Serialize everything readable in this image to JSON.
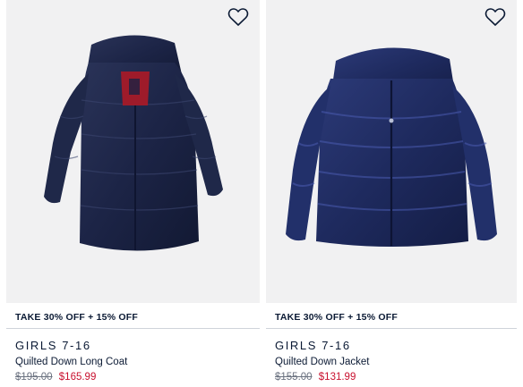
{
  "colors": {
    "text": "#0b1a34",
    "sale_price": "#c8102e",
    "original_price": "#6b7280",
    "image_background": "#f1f1f2",
    "jacket_navy": "#1d2547"
  },
  "products": [
    {
      "promo": "TAKE 30% OFF + 15% OFF",
      "category": "GIRLS 7-16",
      "name": "Quilted Down Long Coat",
      "original_price": "$195.00",
      "sale_price": "$165.99",
      "wishlist_icon": "heart-outline-icon"
    },
    {
      "promo": "TAKE 30% OFF + 15% OFF",
      "category": "GIRLS 7-16",
      "name": "Quilted Down Jacket",
      "original_price": "$155.00",
      "sale_price": "$131.99",
      "wishlist_icon": "heart-outline-icon"
    }
  ]
}
